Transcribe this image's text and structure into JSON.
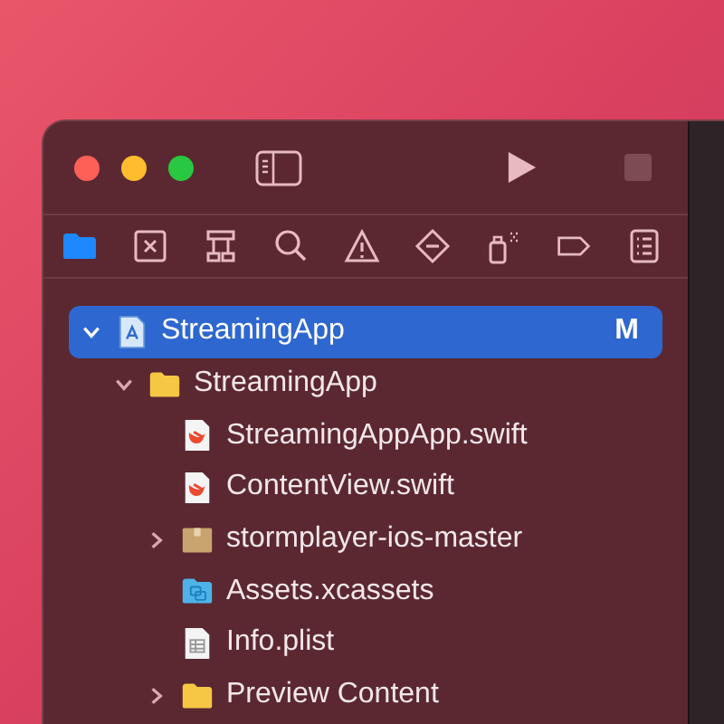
{
  "navigator_tabs": [
    {
      "kind": "folder",
      "selected": true
    },
    {
      "kind": "source-control",
      "selected": false
    },
    {
      "kind": "hierarchy",
      "selected": false
    },
    {
      "kind": "search",
      "selected": false
    },
    {
      "kind": "warning",
      "selected": false
    },
    {
      "kind": "test",
      "selected": false
    },
    {
      "kind": "debug",
      "selected": false
    },
    {
      "kind": "tag",
      "selected": false
    },
    {
      "kind": "report",
      "selected": false
    }
  ],
  "tree": [
    {
      "kind": "project",
      "label": "StreamingApp",
      "badge": "M",
      "selected": true,
      "expanded": true,
      "children": [
        {
          "kind": "folder",
          "label": "StreamingApp",
          "selected": false,
          "expanded": true,
          "children": [
            {
              "kind": "swift",
              "label": "StreamingAppApp.swift",
              "selected": false
            },
            {
              "kind": "swift",
              "label": "ContentView.swift",
              "selected": false
            },
            {
              "kind": "package",
              "label": "stormplayer-ios-master",
              "selected": false,
              "expanded": false
            },
            {
              "kind": "assets",
              "label": "Assets.xcassets",
              "selected": false
            },
            {
              "kind": "plist",
              "label": "Info.plist",
              "selected": false
            },
            {
              "kind": "folder",
              "label": "Preview Content",
              "selected": false,
              "expanded": false
            }
          ]
        }
      ]
    }
  ]
}
